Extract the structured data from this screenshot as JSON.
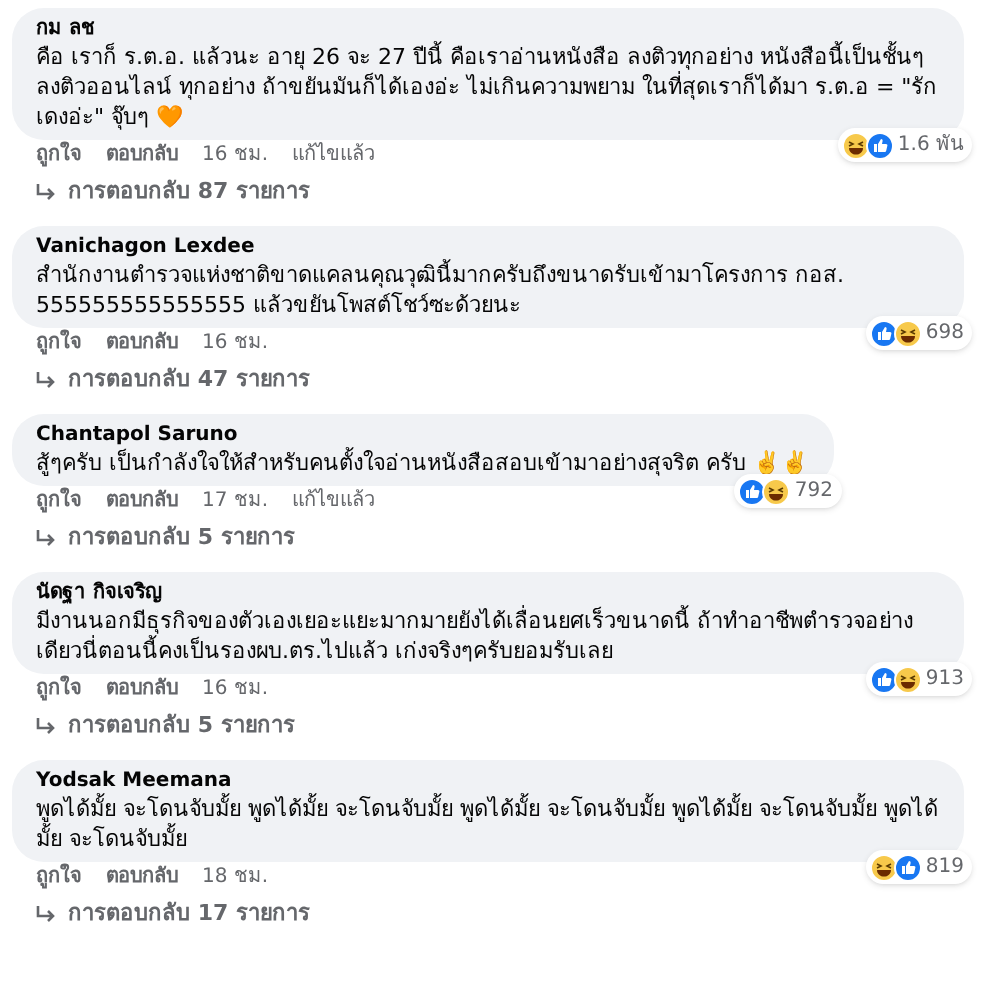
{
  "comments": [
    {
      "author": "กม ลช",
      "text": "คือ เราก็ ร.ต.อ. แล้วนะ อายุ 26 จะ 27 ปีนี้ คือเราอ่านหนังสือ ลงติวทุกอย่าง หนังสือนี้เป็นชั้นๆ ลงติวออนไลน์ ทุกอย่าง ถ้าขยันมันก็ได้เองอ่ะ ไม่เกินความพยาม ในที่สุดเราก็ได้มา ร.ต.อ = \"รักเดงอ่ะ\" จุ๊บๆ 🧡",
      "reactions": [
        {
          "kind": "haha"
        },
        {
          "kind": "like"
        }
      ],
      "count": "1.6 พัน",
      "like": "ถูกใจ",
      "reply": "ตอบกลับ",
      "time": "16 ชม.",
      "edited": "แก้ไขแล้ว",
      "replies": "การตอบกลับ 87 รายการ"
    },
    {
      "author": "Vanichagon Lexdee",
      "text": "สำนักงานตำรวจแห่งชาติขาดแคลนคุณวุฒินี้มากครับถึงขนาดรับเข้ามาโครงการ กอส. 555555555555555 แล้วขยันโพสต์โชว์ซะด้วยนะ",
      "reactions": [
        {
          "kind": "like"
        },
        {
          "kind": "haha"
        }
      ],
      "count": "698",
      "like": "ถูกใจ",
      "reply": "ตอบกลับ",
      "time": "16 ชม.",
      "replies": "การตอบกลับ 47 รายการ"
    },
    {
      "author": "Chantapol Saruno",
      "text": "สู้ๆครับ เป็นกำลังใจให้สำหรับคนตั้งใจอ่านหนังสือสอบเข้ามาอย่างสุจริต ครับ ✌️✌️",
      "reactions": [
        {
          "kind": "like"
        },
        {
          "kind": "haha"
        }
      ],
      "count": "792",
      "like": "ถูกใจ",
      "reply": "ตอบกลับ",
      "time": "17 ชม.",
      "edited": "แก้ไขแล้ว",
      "replies": "การตอบกลับ 5 รายการ"
    },
    {
      "author": "นัดฐา กิจเจริญ",
      "text": "มีงานนอกมีธุรกิจของตัวเองเยอะแยะมากมายยังได้เลื่อนยศเร็วขนาดนี้ ถ้าทำอาชีพตำรวจอย่างเดียวนี่ตอนนี้คงเป็นรองผบ.ตร.ไปแล้ว เก่งจริงๆครับยอมรับเลย",
      "reactions": [
        {
          "kind": "like"
        },
        {
          "kind": "haha"
        }
      ],
      "count": "913",
      "like": "ถูกใจ",
      "reply": "ตอบกลับ",
      "time": "16 ชม.",
      "replies": "การตอบกลับ 5 รายการ"
    },
    {
      "author": "Yodsak Meemana",
      "text": "พูดได้มั้ย จะโดนจับมั้ย พูดได้มั้ย จะโดนจับมั้ย พูดได้มั้ย จะโดนจับมั้ย พูดได้มั้ย จะโดนจับมั้ย พูดได้มั้ย จะโดนจับมั้ย",
      "reactions": [
        {
          "kind": "haha"
        },
        {
          "kind": "like"
        }
      ],
      "count": "819",
      "like": "ถูกใจ",
      "reply": "ตอบกลับ",
      "time": "18 ชม.",
      "replies": "การตอบกลับ 17 รายการ"
    }
  ]
}
